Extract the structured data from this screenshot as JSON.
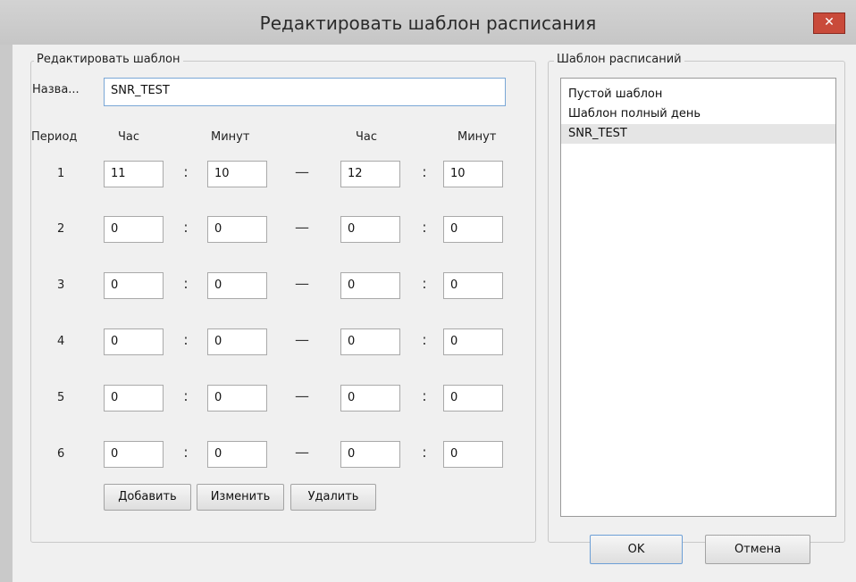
{
  "window": {
    "title": "Редактировать шаблон расписания",
    "close_glyph": "✕"
  },
  "edit_group": {
    "legend": "Редактировать шаблон",
    "name_label": "Назва...",
    "name_value": "SNR_TEST",
    "headers": {
      "period": "Период",
      "start_hour": "Час",
      "start_minute": "Минут",
      "end_hour": "Час",
      "end_minute": "Минут"
    },
    "separator_colon": ":",
    "separator_dash": "—",
    "rows": [
      {
        "period": "1",
        "start_hour": "11",
        "start_minute": "10",
        "end_hour": "12",
        "end_minute": "10"
      },
      {
        "period": "2",
        "start_hour": "0",
        "start_minute": "0",
        "end_hour": "0",
        "end_minute": "0"
      },
      {
        "period": "3",
        "start_hour": "0",
        "start_minute": "0",
        "end_hour": "0",
        "end_minute": "0"
      },
      {
        "period": "4",
        "start_hour": "0",
        "start_minute": "0",
        "end_hour": "0",
        "end_minute": "0"
      },
      {
        "period": "5",
        "start_hour": "0",
        "start_minute": "0",
        "end_hour": "0",
        "end_minute": "0"
      },
      {
        "period": "6",
        "start_hour": "0",
        "start_minute": "0",
        "end_hour": "0",
        "end_minute": "0"
      }
    ],
    "buttons": {
      "add": "Добавить",
      "edit": "Изменить",
      "delete": "Удалить"
    }
  },
  "templates_group": {
    "legend": "Шаблон расписаний",
    "items": [
      "Пустой шаблон",
      "Шаблон полный день",
      "SNR_TEST"
    ],
    "selected_index": 2
  },
  "footer": {
    "ok": "OK",
    "cancel": "Отмена"
  },
  "colors": {
    "titlebar": "#cbcbcb",
    "close": "#c94a3a",
    "selection": "#e5e5e5"
  }
}
